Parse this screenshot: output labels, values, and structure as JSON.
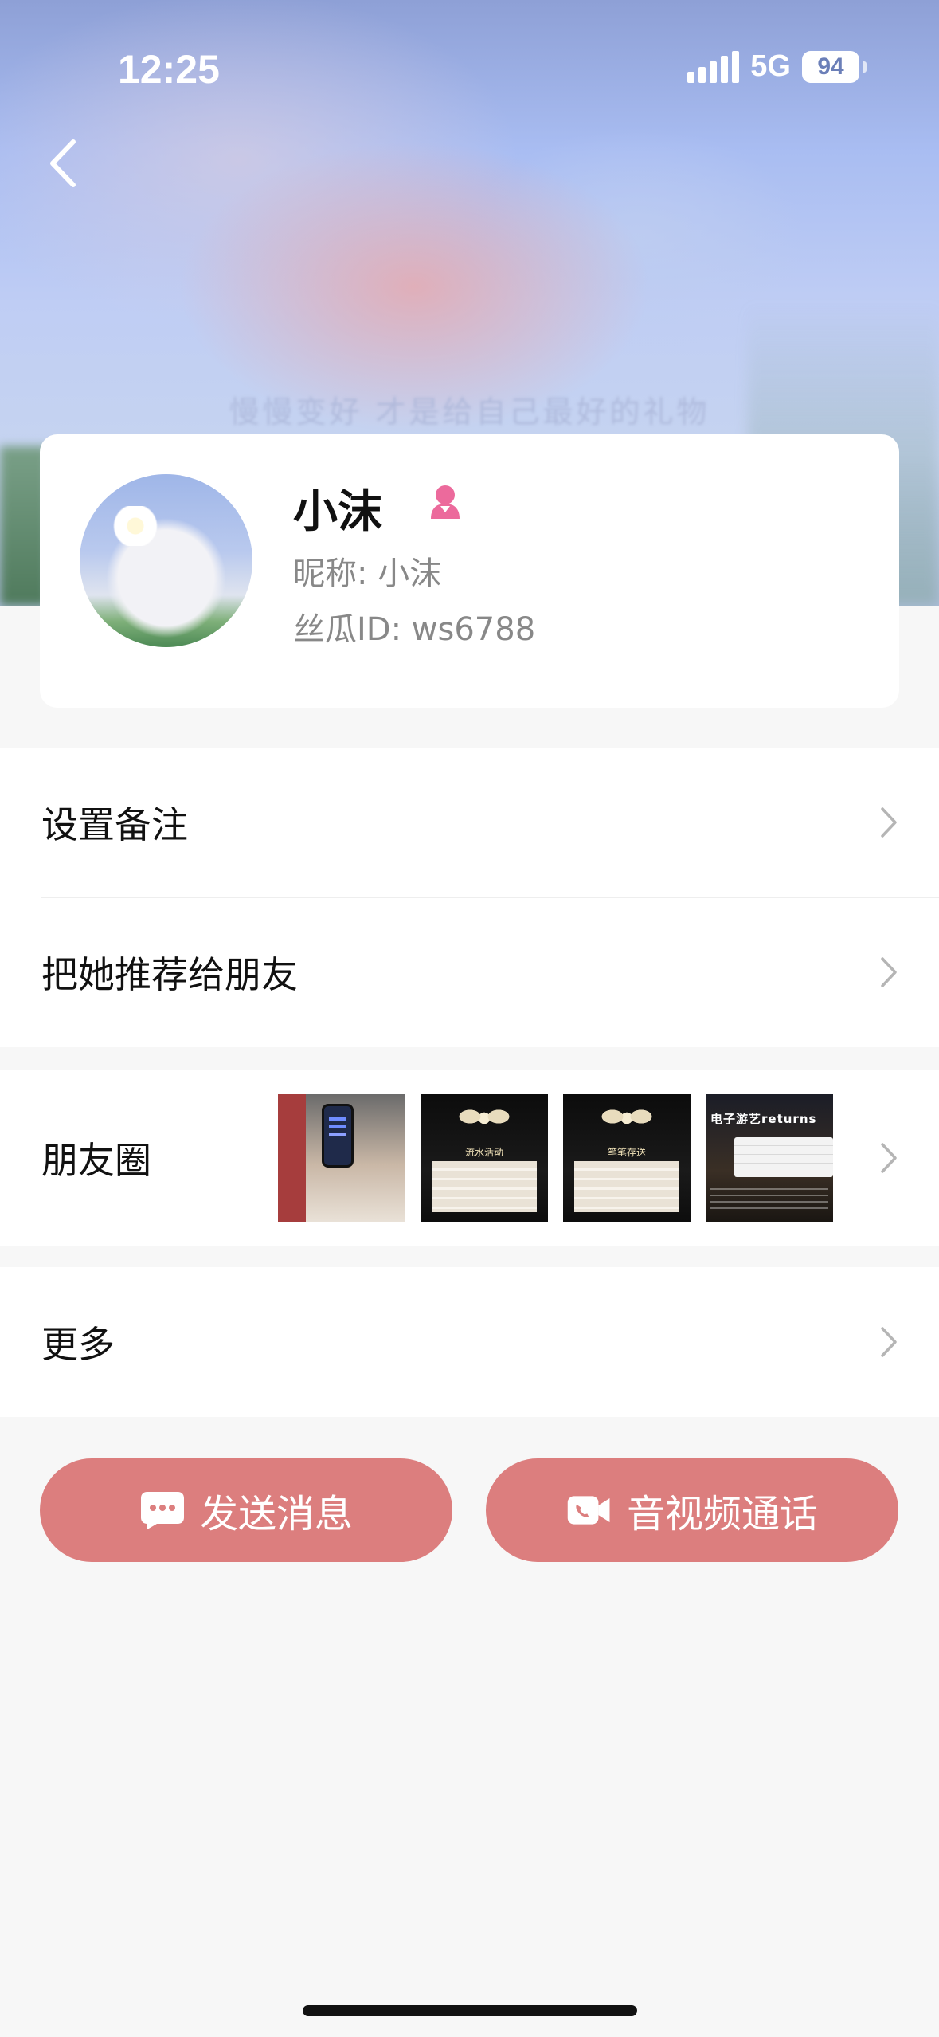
{
  "status_bar": {
    "time": "12:25",
    "network": "5G",
    "battery": "94"
  },
  "hero": {
    "caption": "慢慢变好 才是给自己最好的礼物"
  },
  "profile": {
    "name": "小沫",
    "nickname": "昵称: 小沫",
    "user_id": "丝瓜ID: ws6788",
    "gender": "female",
    "gender_color": "#ec6a9c"
  },
  "menu": {
    "set_remark": "设置备注",
    "recommend_to_friend": "把她推荐给朋友",
    "moments": "朋友圈",
    "more": "更多"
  },
  "moments_thumbs": [
    {
      "title": ""
    },
    {
      "title": "流水活动"
    },
    {
      "title": "笔笔存送"
    },
    {
      "title": "电子游艺returns"
    }
  ],
  "actions": {
    "send_message": "发送消息",
    "av_call": "音视频通话"
  },
  "colors": {
    "accent": "#dc7e7e",
    "background": "#f7f7f7"
  }
}
